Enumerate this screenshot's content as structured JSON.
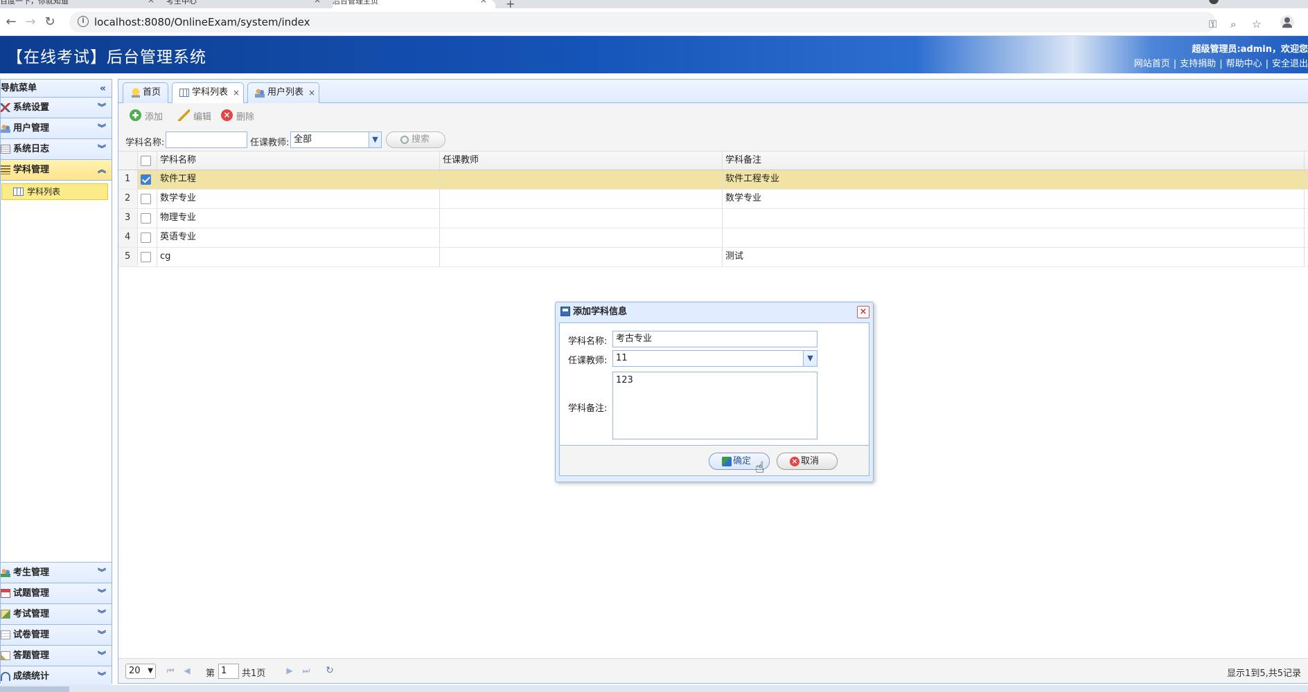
{
  "browser": {
    "tabs": [
      {
        "label": "百度一下，你就知道"
      },
      {
        "label": "考生中心"
      },
      {
        "label": "后台管理主页"
      }
    ],
    "new_tab_label": "+",
    "url": "localhost:8080/OnlineExam/system/index"
  },
  "header": {
    "title": "【在线考试】后台管理系统",
    "user_info": "超级管理员:admin，欢迎您",
    "links": [
      "网站首页",
      "支持捐助",
      "帮助中心",
      "安全退出"
    ],
    "sep": "|"
  },
  "sidebar": {
    "title": "导航菜单",
    "collapse_icon": "«",
    "chevron_down": "︾",
    "chevron_up": "︽",
    "groups_top": [
      {
        "label": "系统设置"
      },
      {
        "label": "用户管理"
      },
      {
        "label": "系统日志"
      },
      {
        "label": "学科管理"
      }
    ],
    "active_sub_item": "学科列表",
    "groups_bottom": [
      {
        "label": "考生管理"
      },
      {
        "label": "试题管理"
      },
      {
        "label": "考试管理"
      },
      {
        "label": "试卷管理"
      },
      {
        "label": "答题管理"
      },
      {
        "label": "成绩统计"
      }
    ]
  },
  "tabs": [
    {
      "label": "首页"
    },
    {
      "label": "学科列表",
      "close": "×"
    },
    {
      "label": "用户列表",
      "close": "×"
    }
  ],
  "toolbar": {
    "add_label": "添加",
    "edit_label": "编辑",
    "delete_label": "删除"
  },
  "search": {
    "name_label": "学科名称:",
    "name_value": "",
    "teacher_label": "任课教师:",
    "teacher_value": "全部",
    "button_label": "搜索",
    "arrow": "▼"
  },
  "grid": {
    "columns": [
      "学科名称",
      "任课教师",
      "学科备注"
    ],
    "rows": [
      {
        "num": "1",
        "name": "软件工程",
        "teacher": "",
        "remark": "软件工程专业",
        "checked": true
      },
      {
        "num": "2",
        "name": "数学专业",
        "teacher": "",
        "remark": "数学专业",
        "checked": false
      },
      {
        "num": "3",
        "name": "物理专业",
        "teacher": "",
        "remark": "",
        "checked": false
      },
      {
        "num": "4",
        "name": "英语专业",
        "teacher": "",
        "remark": "",
        "checked": false
      },
      {
        "num": "5",
        "name": "cg",
        "teacher": "",
        "remark": "测试",
        "checked": false
      }
    ]
  },
  "pager": {
    "page_size": "20",
    "page_prefix": "第",
    "page_value": "1",
    "page_total": "共1页",
    "info": "显示1到5,共5记录",
    "first_icon": "⏮",
    "prev_icon": "◀",
    "next_icon": "▶",
    "last_icon": "⏭",
    "refresh_icon": "↻"
  },
  "dialog": {
    "title": "添加学科信息",
    "close_icon": "×",
    "name_label": "学科名称:",
    "name_value": "考古专业",
    "teacher_label": "任课教师:",
    "teacher_value": "11",
    "remark_label": "学科备注:",
    "remark_value": "123",
    "confirm_label": "确定",
    "cancel_label": "取消"
  },
  "colors": {
    "accent": "#95b8e7",
    "header_blue": "#1554b8",
    "selected_row": "#f0e3a3",
    "active_menu": "#ffe48d"
  }
}
